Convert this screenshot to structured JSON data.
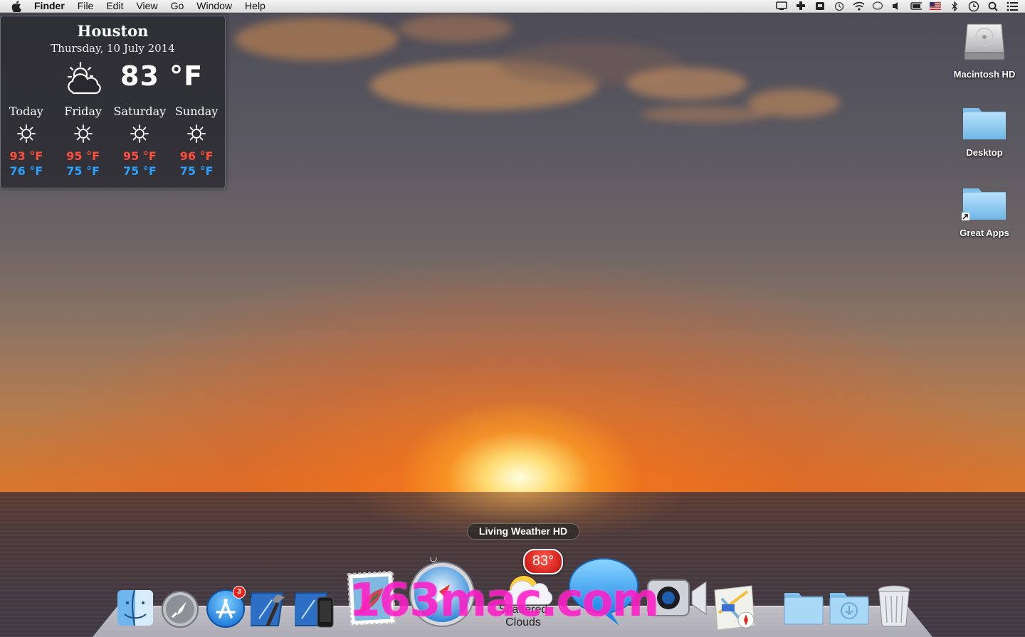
{
  "menubar": {
    "app_name": "Finder",
    "menus": [
      "File",
      "Edit",
      "View",
      "Go",
      "Window",
      "Help"
    ],
    "status_icons": [
      "display-icon",
      "plus-cross-icon",
      "app-tray-icon",
      "time-machine-icon",
      "wifi-icon",
      "chat-bubble-icon",
      "volume-icon",
      "battery-icon",
      "us-flag-icon",
      "bluetooth-icon",
      "clock-icon",
      "spotlight-search-icon",
      "list-menu-icon"
    ]
  },
  "weather_widget": {
    "city": "Houston",
    "date": "Thursday, 10 July 2014",
    "current_temp": "83 °F",
    "current_icon": "partly-cloudy-icon",
    "forecast": [
      {
        "day": "Today",
        "icon": "sun-icon",
        "high": "93 °F",
        "low": "76 °F"
      },
      {
        "day": "Friday",
        "icon": "sun-icon",
        "high": "95 °F",
        "low": "75 °F"
      },
      {
        "day": "Saturday",
        "icon": "sun-icon",
        "high": "95 °F",
        "low": "75 °F"
      },
      {
        "day": "Sunday",
        "icon": "sun-icon",
        "high": "96 °F",
        "low": "75 °F"
      }
    ],
    "colors": {
      "high": "#ff4e3c",
      "low": "#2aa2ff"
    }
  },
  "desktop_icons": [
    {
      "label": "Macintosh HD",
      "icon": "hard-drive-icon"
    },
    {
      "label": "Desktop",
      "icon": "folder-icon"
    },
    {
      "label": "Great Apps",
      "icon": "folder-alias-icon"
    }
  ],
  "dock": {
    "tooltip": "Living Weather HD",
    "app_store_badge": "3",
    "weather_temp_badge": "83°",
    "weather_condition": "Scattered Clouds",
    "items": [
      "finder-icon",
      "launchpad-icon",
      "app-store-icon",
      "xcode-icon",
      "ios-simulator-icon",
      "stamp-app-icon",
      "safari-icon",
      "living-weather-icon",
      "messages-icon",
      "facetime-icon",
      "maps-icon",
      "applications-folder-icon",
      "downloads-folder-icon",
      "trash-icon"
    ]
  },
  "watermark": "163mac.com"
}
